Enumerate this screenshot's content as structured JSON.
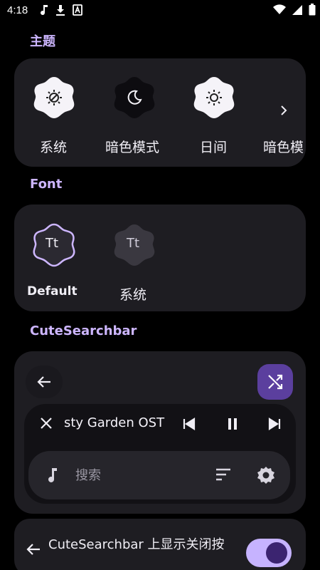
{
  "status_bar": {
    "time": "4:18",
    "left_icons": [
      "music-note-icon",
      "download-icon",
      "app-icon"
    ],
    "right_icons": [
      "wifi-icon",
      "cellular-icon",
      "battery-icon"
    ]
  },
  "theme_section": {
    "title": "主题",
    "items": [
      {
        "label": "系统",
        "icon": "auto-brightness-icon"
      },
      {
        "label": "暗色模式",
        "icon": "moon-icon"
      },
      {
        "label": "日间",
        "icon": "sun-icon"
      },
      {
        "label": "暗色模"
      }
    ],
    "more_icon": "chevron-right-icon"
  },
  "font_section": {
    "title": "Font",
    "items": [
      {
        "glyph": "Tt",
        "label": "Default",
        "selected": true
      },
      {
        "glyph": "Tt",
        "label": "系统",
        "selected": false
      }
    ]
  },
  "searchbar_section": {
    "title": "CuteSearchbar",
    "now_playing_title": "sty Garden OST",
    "search_placeholder": "搜索",
    "toggle_text": "CuteSearchbar 上显示关闭按",
    "toggle_on": true
  },
  "colors": {
    "accent": "#cdb6ff",
    "card_bg": "#1e1d22",
    "shuffle_bg": "#5b3f9e",
    "toggle_track": "#c6b3ff",
    "toggle_thumb": "#3b2470"
  }
}
